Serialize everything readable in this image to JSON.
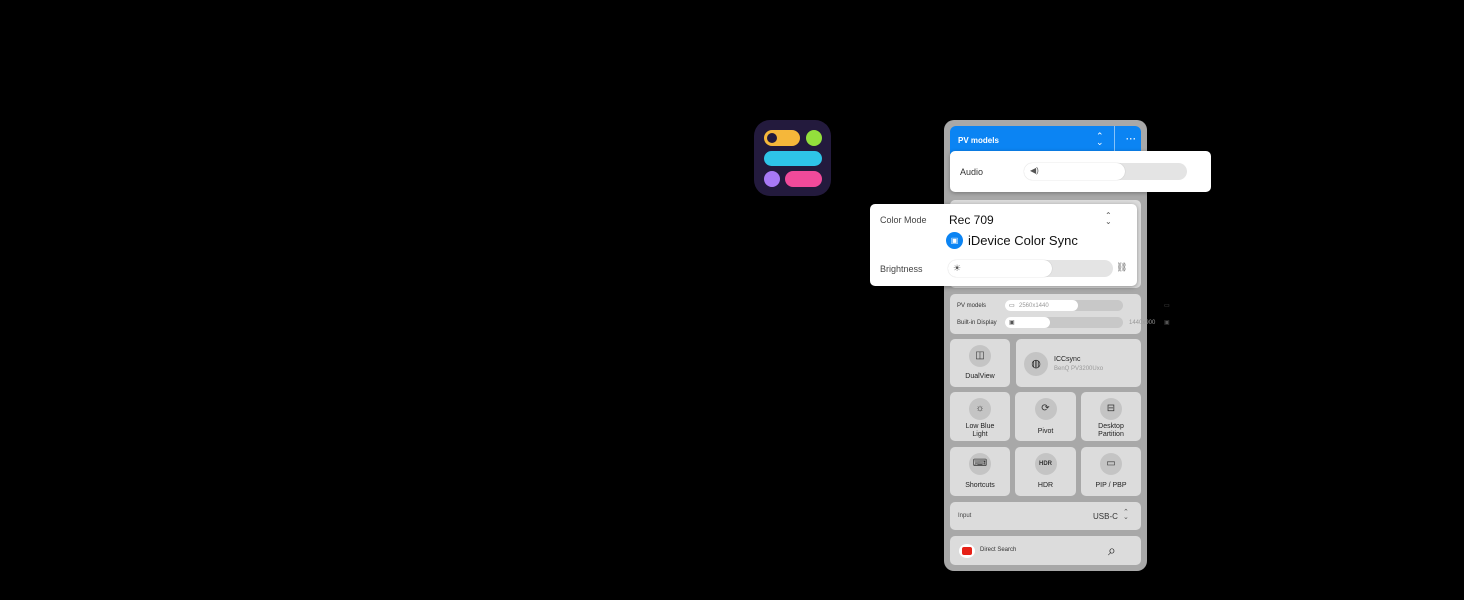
{
  "app_icon": {
    "name": "control-center-app-icon"
  },
  "panel": {
    "header": {
      "title": "PV models",
      "more": "···",
      "chevron": "⌃⌄"
    },
    "resolutions": [
      {
        "label": "PV models",
        "value": "2560x1440",
        "fill": 0.62
      },
      {
        "label": "Built-in Display",
        "value": "1440x900",
        "fill": 0.38
      }
    ],
    "tiles": {
      "dualview": "DualView",
      "icc_name": "ICCsync",
      "icc_sub": "BenQ PV3200Uxo",
      "low_blue": "Low Blue Light",
      "pivot": "Pivot",
      "desktop_partition": "Desktop Partition",
      "shortcuts": "Shortcuts",
      "hdr": "HDR",
      "pip": "PIP / PBP"
    },
    "input": {
      "label": "Input",
      "value": "USB-C"
    },
    "search": {
      "label": "Direct Search"
    }
  },
  "audio_popup": {
    "label": "Audio",
    "level": 0.62
  },
  "color_popup": {
    "mode_label": "Color Mode",
    "mode_value": "Rec 709",
    "sync_label": "iDevice Color Sync",
    "brightness_label": "Brightness",
    "brightness_level": 0.63
  },
  "colors": {
    "accent": "#0b84f3",
    "panel_bg": "#a8a8a8",
    "card_bg": "#dcdcdc"
  }
}
